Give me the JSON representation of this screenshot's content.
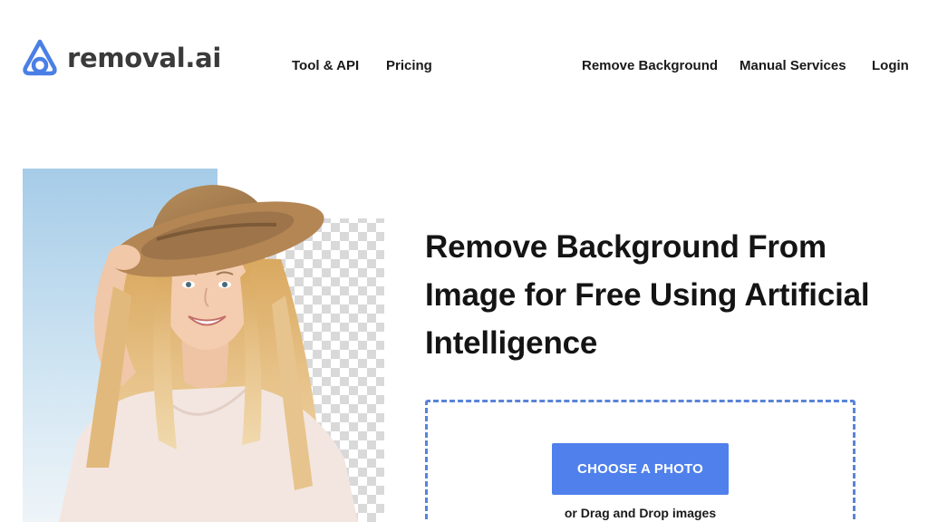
{
  "brand": {
    "name": "removal.ai",
    "logo_color": "#4a7fe6"
  },
  "nav": {
    "tool_api": "Tool & API",
    "pricing": "Pricing",
    "remove_background": "Remove Background",
    "manual_services": "Manual Services",
    "login": "Login"
  },
  "hero": {
    "headline": "Remove Background From Image for Free Using Artificial Intelligence",
    "image_description_icon": "woman-in-hat-photo"
  },
  "upload": {
    "button_label": "CHOOSE A PHOTO",
    "drag_text": "or Drag and Drop images",
    "accent_color": "#4f80ec",
    "border_color": "#5a84d6"
  }
}
